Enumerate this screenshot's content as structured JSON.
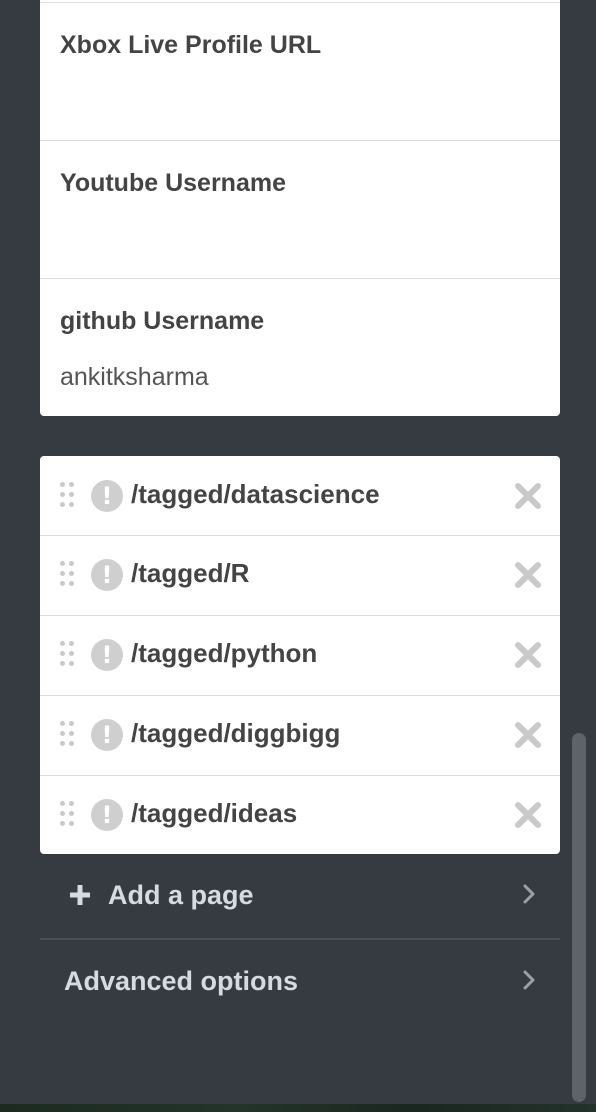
{
  "profile_fields": [
    {
      "label": "Xbox Live Profile URL",
      "value": ""
    },
    {
      "label": "Youtube Username",
      "value": ""
    },
    {
      "label": "github Username",
      "value": "ankitksharma"
    }
  ],
  "pages": [
    {
      "path": "/tagged/datascience"
    },
    {
      "path": "/tagged/R"
    },
    {
      "path": "/tagged/python"
    },
    {
      "path": "/tagged/diggbigg"
    },
    {
      "path": "/tagged/ideas"
    }
  ],
  "add_page": {
    "label": "Add a page",
    "icon": "plus-icon"
  },
  "advanced_options": {
    "label": "Advanced options",
    "icon": "chevron-right-icon"
  },
  "icons": {
    "warning": "exclamation-circle-icon",
    "drag": "drag-handle-icon",
    "remove": "close-icon"
  },
  "colors": {
    "background": "#363b42",
    "card": "#ffffff",
    "text_dark": "#444444",
    "text_light": "#d7dade",
    "icon_gray": "#cfcfcf"
  }
}
